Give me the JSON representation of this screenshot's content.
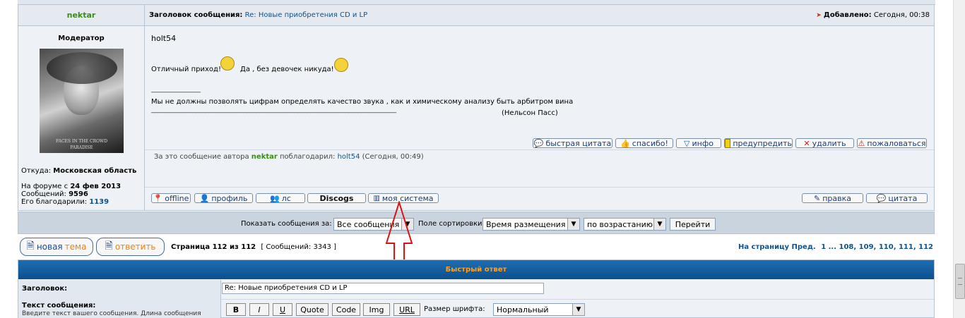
{
  "post": {
    "author": "nektar",
    "subject_prefix": "Заголовок сообщения:",
    "subject": "Re: Новые приобретения CD и LP",
    "added_label": "Добавлено:",
    "added_value": "Сегодня, 00:38",
    "role": "Модератор",
    "avatar_caption1": "FACES IN THE CROWD",
    "avatar_caption2": "PARADISE",
    "location_label": "Откуда:",
    "location_value": "Московская область",
    "since_label": "На форуме с",
    "since_value": "24 фев 2013",
    "messages_label": "Сообщений:",
    "messages_value": "9596",
    "thanks_label": "Его благодарили:",
    "thanks_value": "1139",
    "quote_author": "holt54",
    "line1": "Отличный приход!",
    "line2": "Да , без девочек никуда!",
    "sig_rule": "______________",
    "sig_text": "Мы не должны позволять цифрам определять качество звука , как и химическому анализу быть арбитром вина",
    "sig_rule2": "_____________________________________________________________________________",
    "sig_author": "(Нельсон Пасс)",
    "thanked_prefix": "За это сообщение автора",
    "thanked_author": "nektar",
    "thanked_mid": "поблагодарил:",
    "thanked_user": "holt54",
    "thanked_time": "(Сегодня, 00:49)"
  },
  "post_actions": {
    "quick_quote": "быстрая цитата",
    "thanks": "спасибо!",
    "info": "инфо",
    "warn": "предупредить",
    "delete": "удалить",
    "report": "пожаловаться"
  },
  "profile_actions": {
    "offline": "offline",
    "profile": "профиль",
    "pm": "лс",
    "discogs": "Discogs",
    "my_system": "моя система",
    "edit": "правка",
    "quote": "цитата"
  },
  "sort_bar": {
    "show_label": "Показать сообщения за:",
    "show_value": "Все сообщения",
    "sort_label": "Поле сортировки",
    "sort_value": "Время размещения",
    "order_value": "по возрастанию",
    "go": "Перейти"
  },
  "pagination": {
    "new_topic_a": "новая",
    "new_topic_b": "тема",
    "reply": "ответить",
    "page_info": "Страница 112 из 112",
    "count_info": "[ Сообщений: 3343 ]",
    "goto_label": "На страницу",
    "prev": "Пред.",
    "pages": "1 ... 108, 109, 110, 111, 112"
  },
  "quick_reply": {
    "title": "Быстрый ответ",
    "subject_label": "Заголовок:",
    "subject_value": "Re: Новые приобретения CD и LP",
    "text_label": "Текст сообщения:",
    "text_hint": "Введите текст вашего сообщения. Длина сообщения",
    "bold": "B",
    "italic": "I",
    "underline": "U",
    "quote": "Quote",
    "code": "Code",
    "img": "Img",
    "url": "URL",
    "font_size_label": "Размер шрифта:",
    "font_size_value": "Нормальный"
  }
}
